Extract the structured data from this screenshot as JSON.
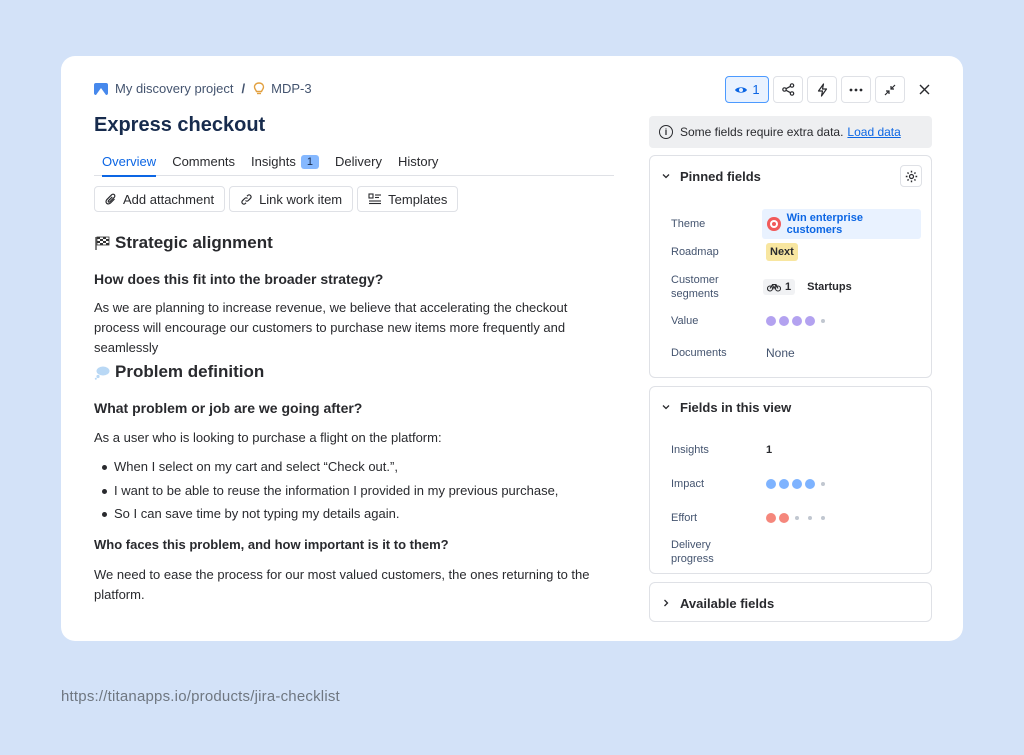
{
  "breadcrumb": {
    "project": "My discovery project",
    "separator": "/",
    "issue_key": "MDP-3"
  },
  "title": "Express checkout",
  "tabs": [
    {
      "label": "Overview",
      "active": true
    },
    {
      "label": "Comments"
    },
    {
      "label": "Insights",
      "badge": "1"
    },
    {
      "label": "Delivery"
    },
    {
      "label": "History"
    }
  ],
  "actions": {
    "attachment": "Add attachment",
    "link": "Link work item",
    "templates": "Templates"
  },
  "toolbar": {
    "watch_count": "1"
  },
  "sections": {
    "strategic": {
      "heading": "Strategic alignment",
      "question": "How does this fit into the broader strategy?",
      "body": "As we are planning to increase revenue, we believe that accelerating the checkout process will encourage our customers to purchase new items more frequently and seamlessly"
    },
    "problem": {
      "heading": "Problem definition",
      "question": "What problem or job are we going after?",
      "intro": "As a user who is looking to purchase a flight on the platform:",
      "bullets": [
        "When I select on my cart and select “Check out.”,",
        "I want to be able to reuse the information I provided in my previous purchase,",
        "So I can save time by not typing my details again."
      ],
      "question2": "Who faces this problem, and how important is it to them?",
      "body2": "We need to ease the process for our most valued customers, the ones returning to the platform."
    }
  },
  "banner": {
    "text": "Some fields require extra data.",
    "link": "Load data"
  },
  "pinned": {
    "title": "Pinned fields",
    "theme_label": "Theme",
    "theme_value": "Win enterprise customers",
    "roadmap_label": "Roadmap",
    "roadmap_value": "Next",
    "segments_label": "Customer segments",
    "segments_count": "1",
    "segments_value": "Startups",
    "value_label": "Value",
    "value_rating": 4,
    "value_max": 5,
    "documents_label": "Documents",
    "documents_value": "None"
  },
  "view": {
    "title": "Fields in this view",
    "insights_label": "Insights",
    "insights_value": "1",
    "impact_label": "Impact",
    "impact_rating": 4,
    "impact_max": 5,
    "effort_label": "Effort",
    "effort_rating": 2,
    "effort_max": 5,
    "delivery_label": "Delivery progress"
  },
  "available": {
    "title": "Available fields"
  },
  "colors": {
    "value_dot": "#b3a2f0",
    "impact_dot": "#7eb3ff",
    "effort_dot": "#f5877c",
    "accent": "#0c66e4"
  },
  "footer_url": "https://titanapps.io/products/jira-checklist"
}
